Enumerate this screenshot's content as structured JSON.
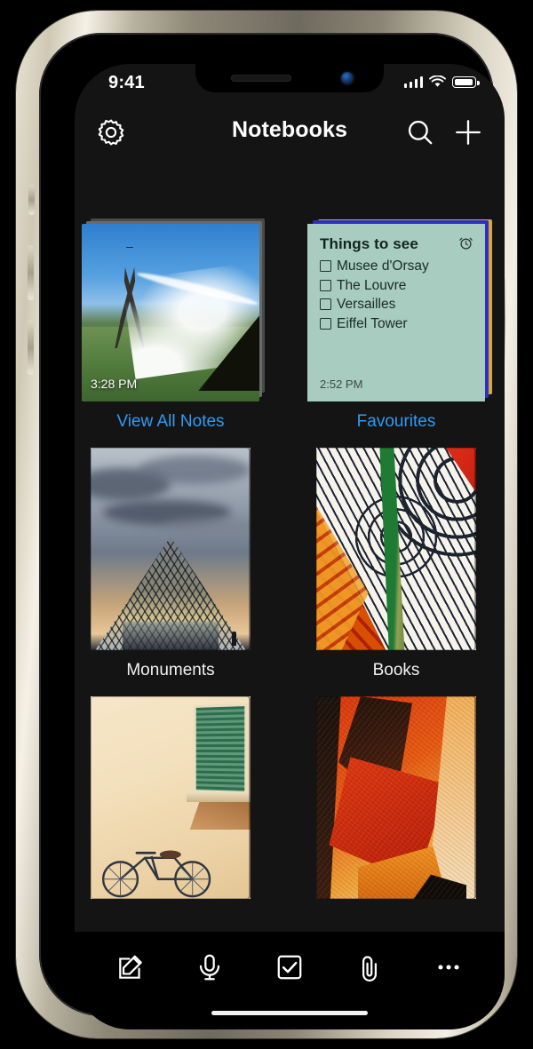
{
  "device": {
    "status_bar": {
      "time": "9:41",
      "signal_icon": "cellular-bars-icon",
      "wifi_icon": "wifi-icon",
      "battery_icon": "battery-icon"
    },
    "home_indicator": "home-indicator"
  },
  "navbar": {
    "title": "Notebooks",
    "settings_icon": "gear-icon",
    "search_icon": "search-icon",
    "add_icon": "plus-icon"
  },
  "grid": {
    "items": [
      {
        "label": "View All Notes",
        "label_color": "#2f9bf2",
        "kind": "photo-stack",
        "art": "eiffel-tower-fountain",
        "timestamp": "3:28 PM"
      },
      {
        "label": "Favourites",
        "label_color": "#2f9bf2",
        "kind": "sticky-note",
        "art": "things-to-see-note"
      },
      {
        "label": "Monuments",
        "label_color": "#f2f2f2",
        "kind": "notebook",
        "art": "louvre-pyramid"
      },
      {
        "label": "Books",
        "label_color": "#f2f2f2",
        "kind": "notebook",
        "art": "orange-collage"
      },
      {
        "label": "",
        "label_color": "#f2f2f2",
        "kind": "notebook",
        "art": "bicycle-wall"
      },
      {
        "label": "",
        "label_color": "#f2f2f2",
        "kind": "notebook",
        "art": "red-abstract"
      }
    ]
  },
  "note": {
    "title": "Things to see",
    "reminder_icon": "alarm-clock-icon",
    "timestamp": "2:52 PM",
    "background": "#a8ccc0",
    "items": [
      {
        "text": "Musee d'Orsay",
        "checked": false
      },
      {
        "text": "The Louvre",
        "checked": false
      },
      {
        "text": "Versailles",
        "checked": false
      },
      {
        "text": "Eiffel Tower",
        "checked": false
      }
    ]
  },
  "toolbar": {
    "buttons": [
      {
        "name": "compose-icon",
        "label": "Compose"
      },
      {
        "name": "microphone-icon",
        "label": "Record"
      },
      {
        "name": "checklist-icon",
        "label": "Checklist"
      },
      {
        "name": "paperclip-icon",
        "label": "Attach"
      },
      {
        "name": "more-icon",
        "label": "More"
      }
    ]
  }
}
